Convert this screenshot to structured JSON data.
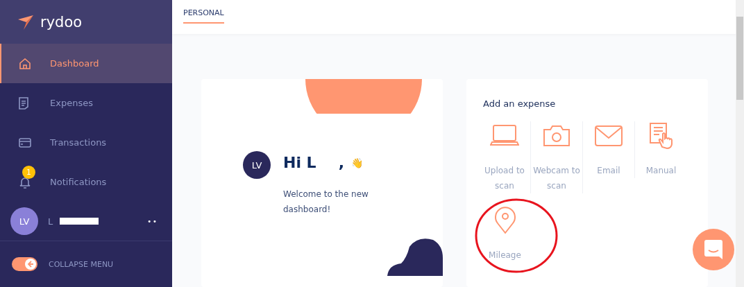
{
  "sidebar": {
    "logo": "rydoo",
    "items": [
      {
        "kind": "home",
        "label": "Dashboard",
        "selected": true
      },
      {
        "kind": "receipt",
        "label": "Expenses",
        "selected": false
      },
      {
        "kind": "card",
        "label": "Transactions",
        "selected": false
      },
      {
        "kind": "bell",
        "label": "Notifications",
        "selected": false,
        "badge": "1"
      }
    ],
    "user": {
      "initials": "LV",
      "name": "L",
      "more": "••"
    },
    "collapse": {
      "label": "COLLAPSE MENU",
      "on": true
    }
  },
  "tabs": [
    {
      "label": "PERSONAL",
      "selected": true
    }
  ],
  "welcome": {
    "initials": "LV",
    "greeting": "Hi L",
    "comma": ",",
    "wave": "👋",
    "message": "Welcome to the new dashboard!"
  },
  "add_expense": {
    "title": "Add an expense",
    "options": [
      {
        "kind": "upload",
        "label": "Upload to scan"
      },
      {
        "kind": "webcam",
        "label": "Webcam to scan"
      },
      {
        "kind": "email",
        "label": "Email"
      },
      {
        "kind": "manual",
        "label": "Manual"
      },
      {
        "kind": "mileage",
        "label": "Mileage",
        "circled": true
      }
    ]
  }
}
